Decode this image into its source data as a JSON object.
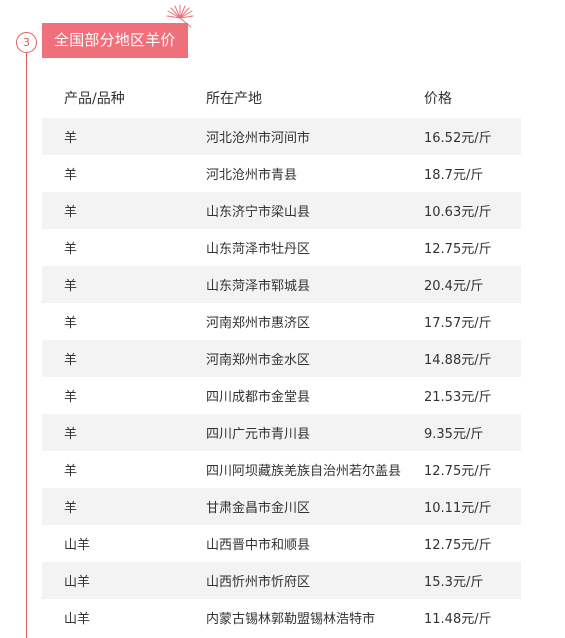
{
  "section": {
    "step_number": "3",
    "title": "全国部分地区羊价"
  },
  "icons": {
    "decoration": "firework-spark-icon"
  },
  "colors": {
    "accent": "#ef6f7a",
    "timeline": "#d9605a",
    "row_shade": "#f3f3f3"
  },
  "table": {
    "columns": [
      "产品/品种",
      "所在产地",
      "价格"
    ],
    "rows": [
      {
        "product": "羊",
        "origin": "河北沧州市河间市",
        "price": "16.52元/斤"
      },
      {
        "product": "羊",
        "origin": "河北沧州市青县",
        "price": "18.7元/斤"
      },
      {
        "product": "羊",
        "origin": "山东济宁市梁山县",
        "price": "10.63元/斤"
      },
      {
        "product": "羊",
        "origin": "山东菏泽市牡丹区",
        "price": "12.75元/斤"
      },
      {
        "product": "羊",
        "origin": "山东菏泽市郓城县",
        "price": "20.4元/斤"
      },
      {
        "product": "羊",
        "origin": "河南郑州市惠济区",
        "price": "17.57元/斤"
      },
      {
        "product": "羊",
        "origin": "河南郑州市金水区",
        "price": "14.88元/斤"
      },
      {
        "product": "羊",
        "origin": "四川成都市金堂县",
        "price": "21.53元/斤"
      },
      {
        "product": "羊",
        "origin": "四川广元市青川县",
        "price": "9.35元/斤"
      },
      {
        "product": "羊",
        "origin": "四川阿坝藏族羌族自治州若尔盖县",
        "price": "12.75元/斤"
      },
      {
        "product": "羊",
        "origin": "甘肃金昌市金川区",
        "price": "10.11元/斤"
      },
      {
        "product": "山羊",
        "origin": "山西晋中市和顺县",
        "price": "12.75元/斤"
      },
      {
        "product": "山羊",
        "origin": "山西忻州市忻府区",
        "price": "15.3元/斤"
      },
      {
        "product": "山羊",
        "origin": "内蒙古锡林郭勒盟锡林浩特市",
        "price": "11.48元/斤"
      }
    ]
  }
}
